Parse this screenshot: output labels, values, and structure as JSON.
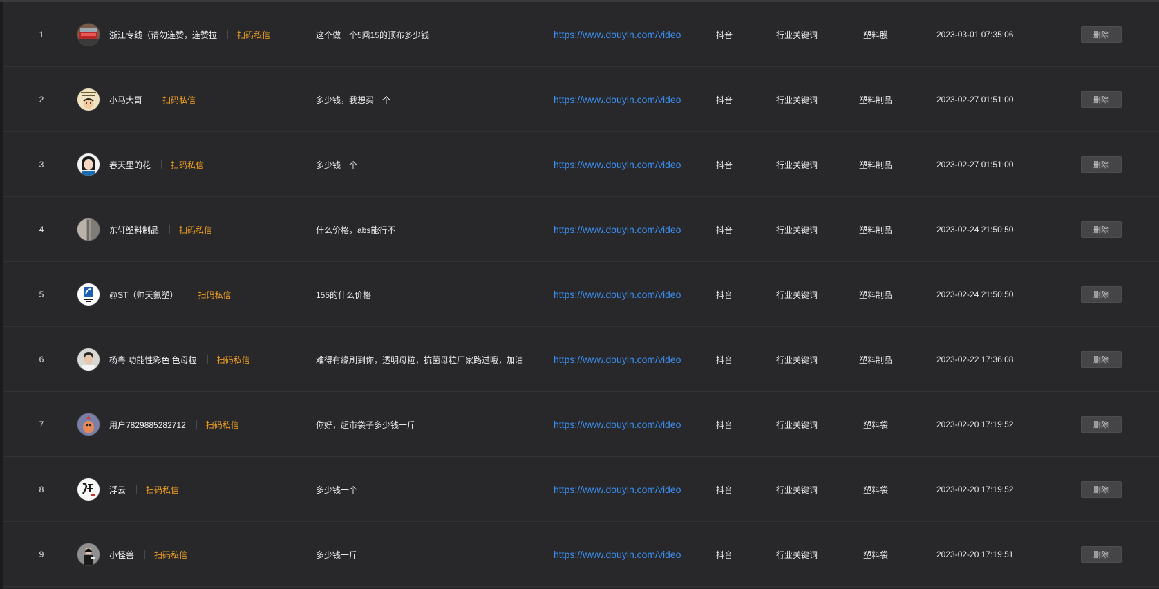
{
  "action_label": "删除",
  "dm_label": "扫码私信",
  "rows": [
    {
      "index": "1",
      "avatar": "avatar-red-train",
      "user": "浙江专线（请勿连赞，连赞拉",
      "comment": "这个做一个5乘15的顶布多少钱",
      "url": "https://www.douyin.com/video",
      "platform": "抖音",
      "source": "行业关键词",
      "keyword": "塑料膜",
      "time": "2023-03-01 07:35:06"
    },
    {
      "index": "2",
      "avatar": "avatar-cartoon-text",
      "user": "小马大哥",
      "comment": "多少钱，我想买一个",
      "url": "https://www.douyin.com/video",
      "platform": "抖音",
      "source": "行业关键词",
      "keyword": "塑料制品",
      "time": "2023-02-27 01:51:00"
    },
    {
      "index": "3",
      "avatar": "avatar-woman",
      "user": "春天里的花",
      "comment": "多少钱一个",
      "url": "https://www.douyin.com/video",
      "platform": "抖音",
      "source": "行业关键词",
      "keyword": "塑料制品",
      "time": "2023-02-27 01:51:00"
    },
    {
      "index": "4",
      "avatar": "avatar-grey-photo",
      "user": "东轩塑料制品",
      "comment": "什么价格，abs能行不",
      "url": "https://www.douyin.com/video",
      "platform": "抖音",
      "source": "行业关键词",
      "keyword": "塑料制品",
      "time": "2023-02-24 21:50:50"
    },
    {
      "index": "5",
      "avatar": "avatar-blue-logo",
      "user": "@ST（帅天氟塑）",
      "comment": "155的什么价格",
      "url": "https://www.douyin.com/video",
      "platform": "抖音",
      "source": "行业关键词",
      "keyword": "塑料制品",
      "time": "2023-02-24 21:50:50"
    },
    {
      "index": "6",
      "avatar": "avatar-man",
      "user": "杨粤 功能性彩色 色母粒",
      "comment": "难得有缘刷到你，透明母粒，抗菌母粒厂家路过哦，加油",
      "url": "https://www.douyin.com/video",
      "platform": "抖音",
      "source": "行业关键词",
      "keyword": "塑料制品",
      "time": "2023-02-22 17:36:08"
    },
    {
      "index": "7",
      "avatar": "avatar-chicken",
      "user": "用户7829885282712",
      "comment": "你好，超市袋子多少钱一斤",
      "url": "https://www.douyin.com/video",
      "platform": "抖音",
      "source": "行业关键词",
      "keyword": "塑料袋",
      "time": "2023-02-20 17:19:52"
    },
    {
      "index": "8",
      "avatar": "avatar-calligraphy",
      "user": "浮云",
      "comment": "多少钱一个",
      "url": "https://www.douyin.com/video",
      "platform": "抖音",
      "source": "行业关键词",
      "keyword": "塑料袋",
      "time": "2023-02-20 17:19:52"
    },
    {
      "index": "9",
      "avatar": "avatar-person-dark",
      "user": "小怪兽",
      "comment": "多少钱一斤",
      "url": "https://www.douyin.com/video",
      "platform": "抖音",
      "source": "行业关键词",
      "keyword": "塑料袋",
      "time": "2023-02-20 17:19:51"
    }
  ]
}
